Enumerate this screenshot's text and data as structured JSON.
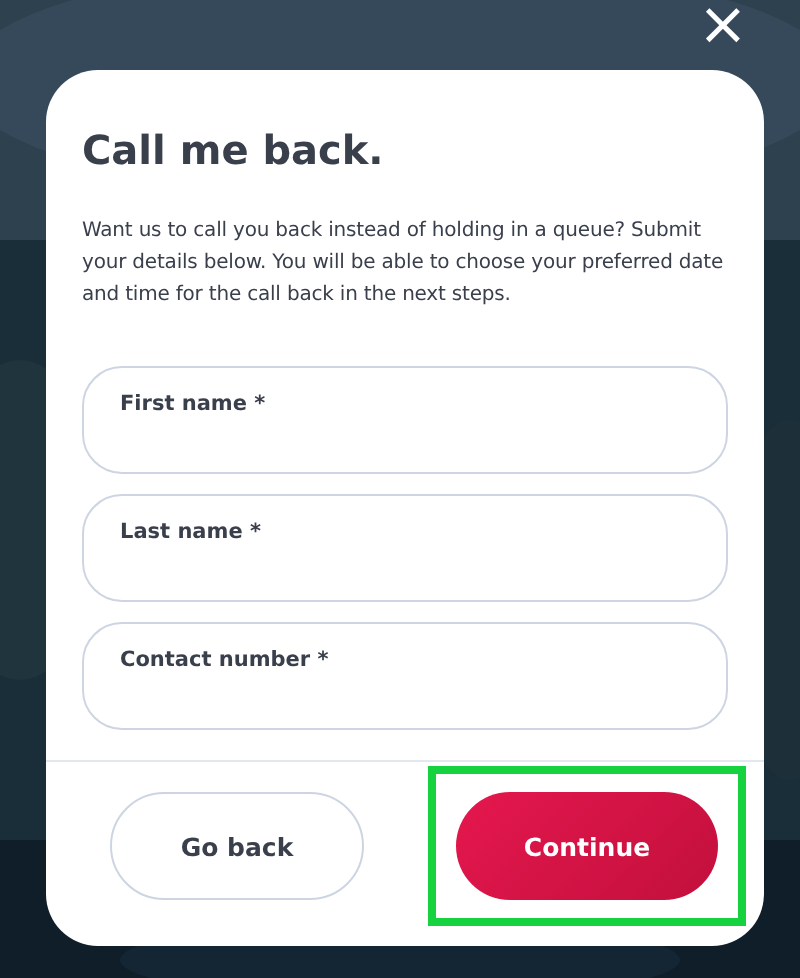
{
  "close_button": {
    "label": "×"
  },
  "dialog": {
    "title": "Call me back.",
    "description": "Want us to call you back instead of holding in a queue? Submit your details below. You will be able to choose your preferred date and time for the call back in the next steps.",
    "fields": [
      {
        "label": "First name *"
      },
      {
        "label": "Last name *"
      },
      {
        "label": "Contact number *"
      }
    ],
    "buttons": [
      {
        "label": "Go back",
        "kind": "secondary",
        "highlighted": false
      },
      {
        "label": "Continue",
        "kind": "primary",
        "highlighted": true
      }
    ]
  }
}
